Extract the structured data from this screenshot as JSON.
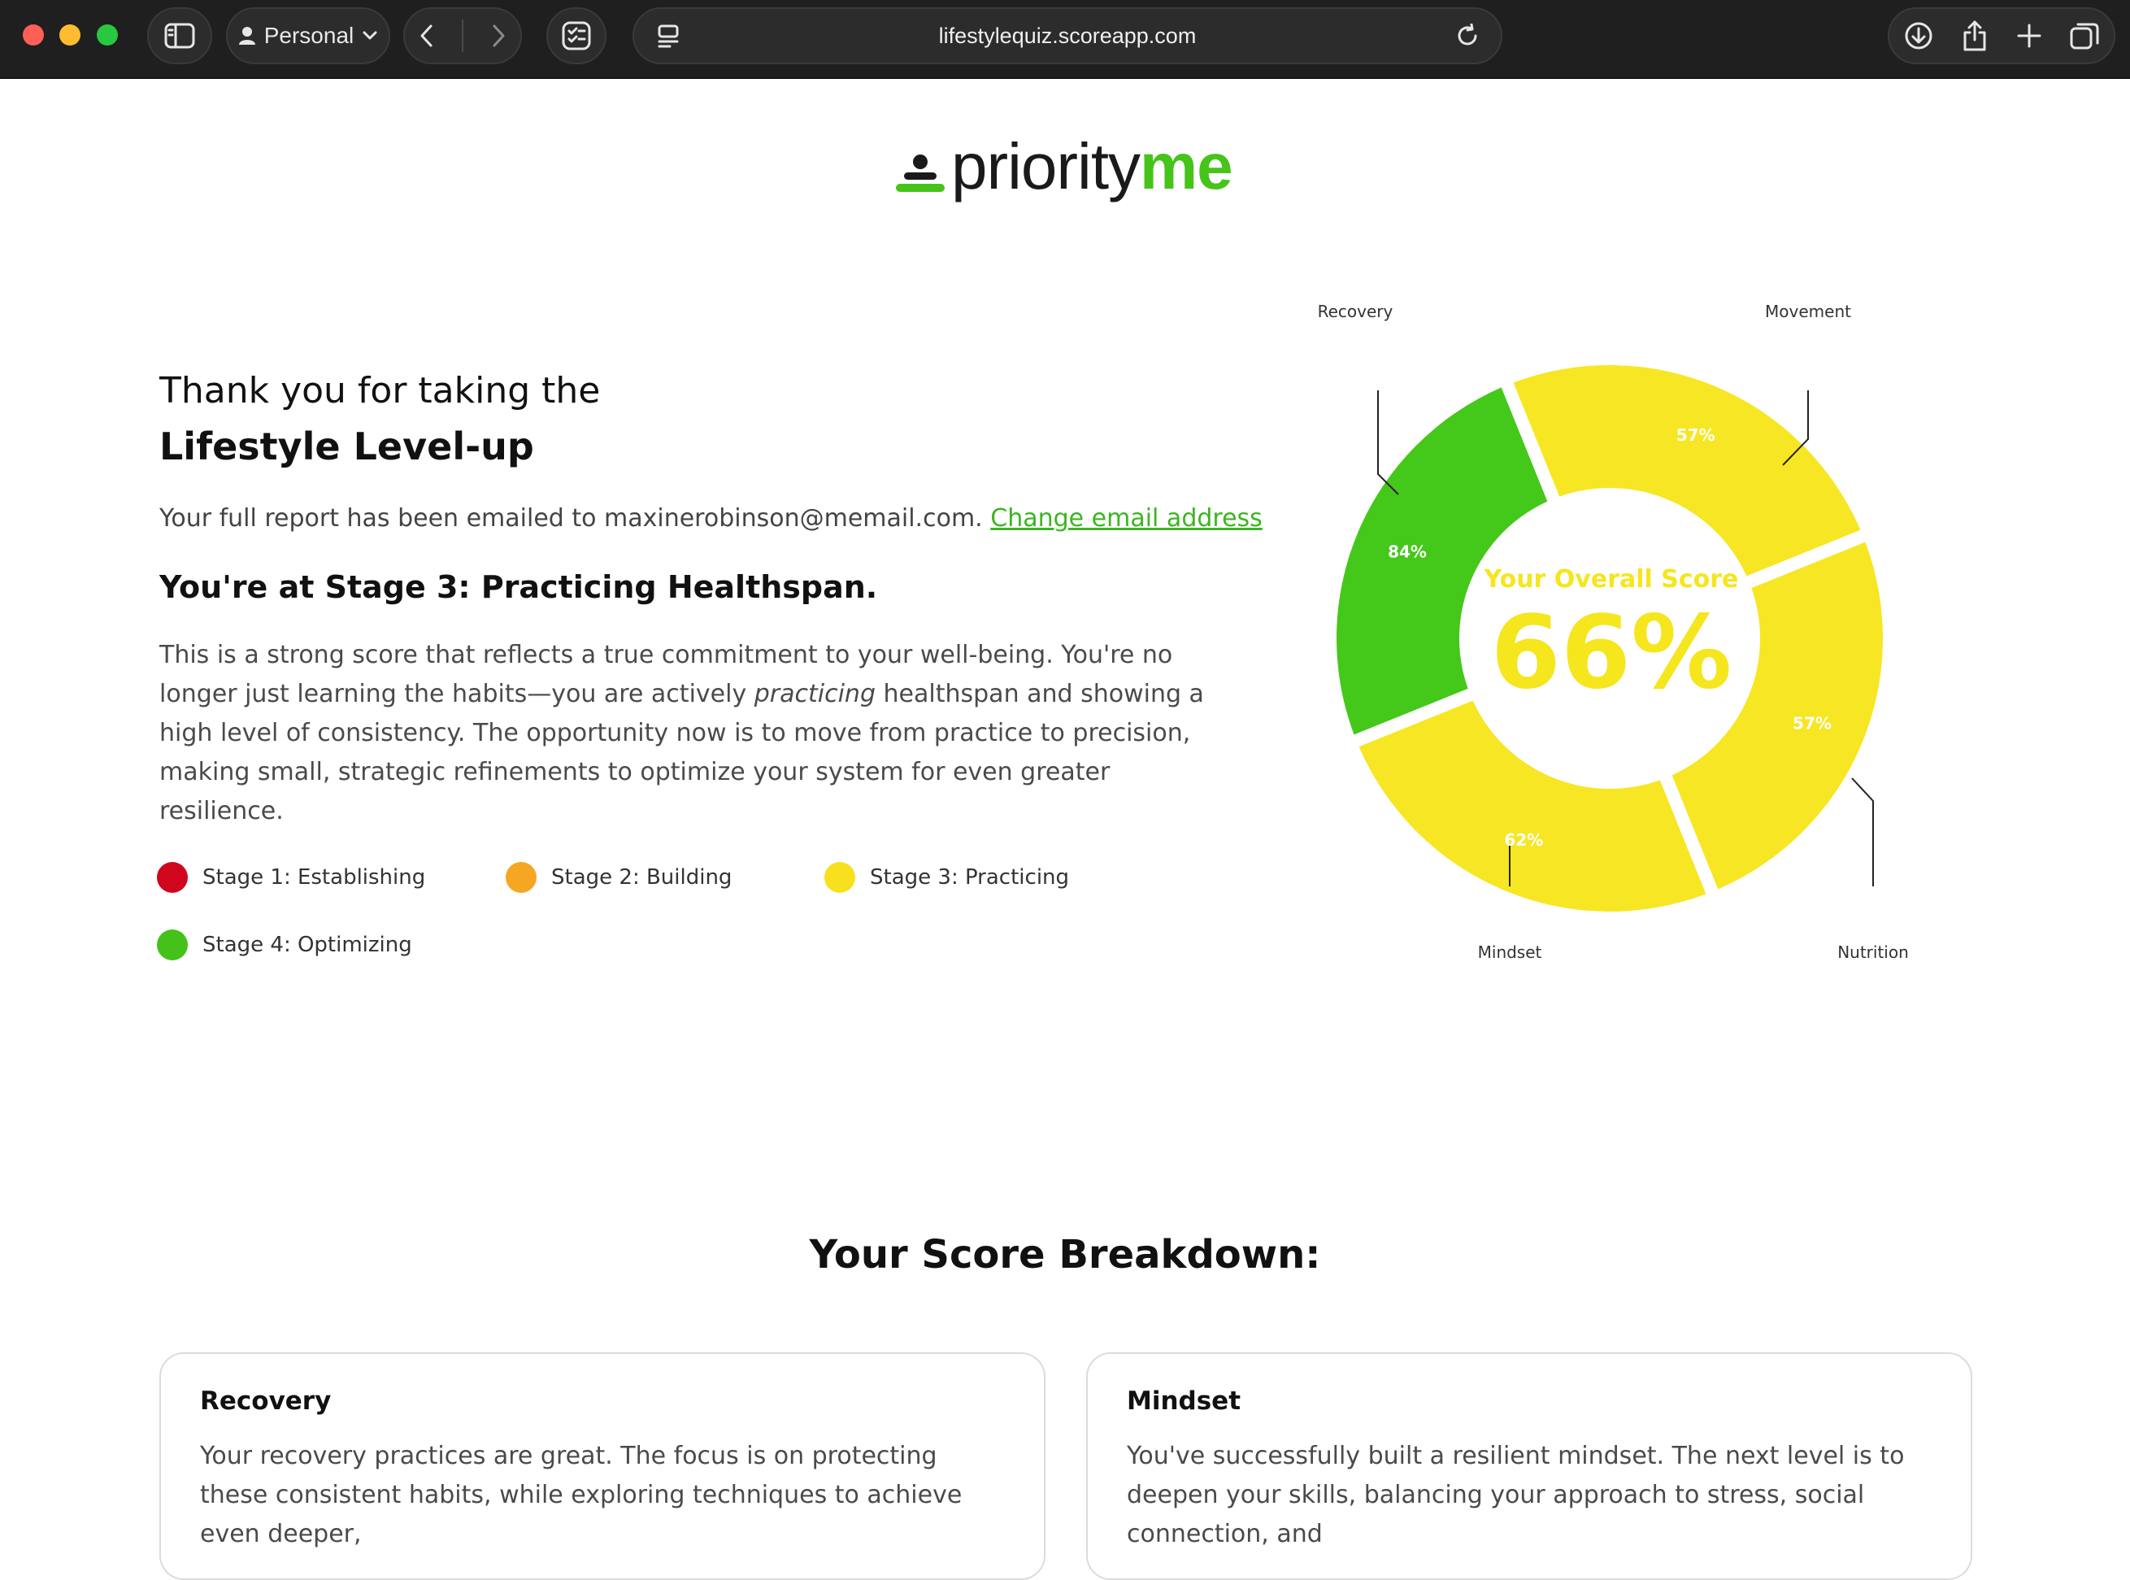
{
  "browser": {
    "profile_label": "Personal",
    "url": "lifestylequiz.scoreapp.com"
  },
  "logo": {
    "part1": "priority",
    "part2": "me"
  },
  "intro": {
    "thank_text": "Thank you for taking the",
    "quiz_name": "Lifestyle Level-up",
    "email_text": "Your full report has been emailed to maxinerobinson@memail.com.",
    "change_email_link": "Change email address",
    "stage_heading": "You're at Stage 3: Practicing Healthspan.",
    "description_before": "This is a strong score that reflects a true commitment to your well-being. You're no longer just learning the habits—you are actively",
    "description_em": "practicing",
    "description_after": "healthspan and showing a high level of consistency. The opportunity now is to move from practice to precision, making small, strategic refinements to optimize your system for even greater resilience."
  },
  "stages": [
    {
      "label": "Stage 1: Establishing",
      "color": "#d0061d"
    },
    {
      "label": "Stage 2: Building",
      "color": "#f5a623"
    },
    {
      "label": "Stage 3: Practicing",
      "color": "#f7e11e"
    },
    {
      "label": "Stage 4: Optimizing",
      "color": "#44c21a"
    }
  ],
  "chart_data": {
    "type": "pie",
    "donut": true,
    "center_title": "Your Overall Score",
    "center_value": "66%",
    "categories": [
      "Recovery",
      "Movement",
      "Nutrition",
      "Mindset"
    ],
    "values": [
      84,
      57,
      57,
      62
    ],
    "value_labels": [
      "84%",
      "57%",
      "57%",
      "62%"
    ],
    "colors": [
      "#44c81a",
      "#f7e623",
      "#f7e623",
      "#f7e623"
    ]
  },
  "breakdown": {
    "title": "Your Score Breakdown:",
    "cards": [
      {
        "title": "Recovery",
        "text": "Your recovery practices are great. The focus is on protecting these consistent habits, while exploring techniques to achieve even deeper,"
      },
      {
        "title": "Mindset",
        "text": "You've successfully built a resilient mindset. The next level is to deepen your skills, balancing your approach to stress, social connection, and"
      }
    ]
  }
}
